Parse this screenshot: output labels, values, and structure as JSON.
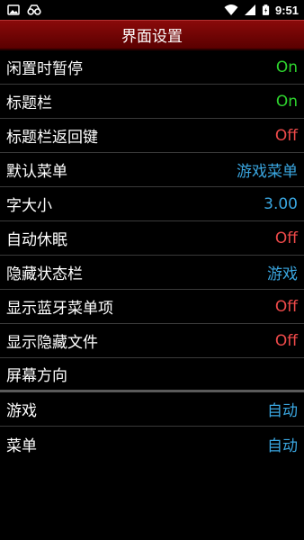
{
  "status_bar": {
    "time": "9:51",
    "left_icons": [
      "image-icon",
      "glasses-icon"
    ],
    "right_icons": [
      "wifi-icon",
      "signal-icon",
      "battery-icon"
    ]
  },
  "header": {
    "title": "界面设置"
  },
  "colors": {
    "header_bg": "#6e0505",
    "on": "#2ed52e",
    "off": "#ef4a4a",
    "blue": "#3aa6e0",
    "divider": "#3a3a3a"
  },
  "settings": [
    {
      "label": "闲置时暂停",
      "value": "On",
      "kind": "on"
    },
    {
      "label": "标题栏",
      "value": "On",
      "kind": "on"
    },
    {
      "label": "标题栏返回键",
      "value": "Off",
      "kind": "off"
    },
    {
      "label": "默认菜单",
      "value": "游戏菜单",
      "kind": "blue"
    },
    {
      "label": "字大小",
      "value": "3.00",
      "kind": "blue"
    },
    {
      "label": "自动休眠",
      "value": "Off",
      "kind": "off"
    },
    {
      "label": "隐藏状态栏",
      "value": "游戏",
      "kind": "blue"
    },
    {
      "label": "显示蓝牙菜单项",
      "value": "Off",
      "kind": "off"
    },
    {
      "label": "显示隐藏文件",
      "value": "Off",
      "kind": "off"
    },
    {
      "label": "屏幕方向",
      "value": "",
      "kind": "none"
    },
    {
      "label": "游戏",
      "value": "自动",
      "kind": "blue"
    },
    {
      "label": "菜单",
      "value": "自动",
      "kind": "blue"
    }
  ]
}
